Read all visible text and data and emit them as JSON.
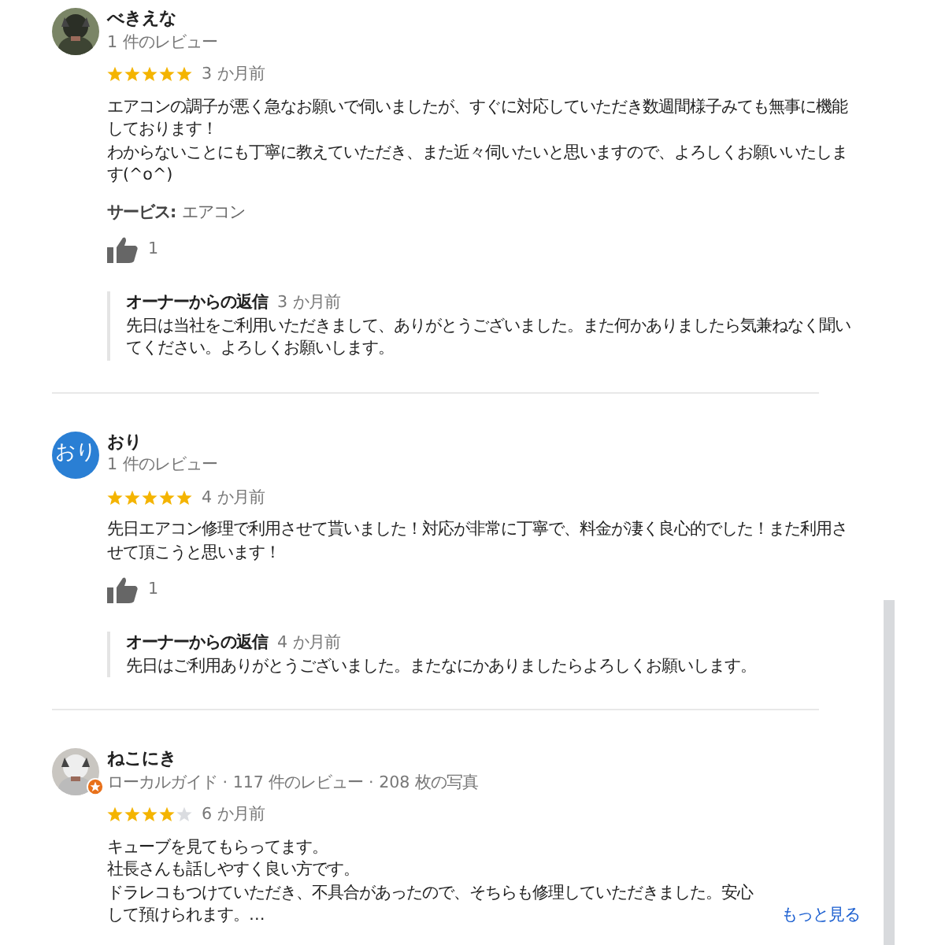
{
  "reviews": [
    {
      "name": "べきえな",
      "avatar": {
        "kind": "picture",
        "local_guide": false
      },
      "meta": "1 件のレビュー",
      "stars": 5,
      "time": "3 か月前",
      "paragraphs": [
        "エアコンの調子が悪く急なお願いで伺いましたが、すぐに対応していただき数週間様子みても無事に機能しております！",
        "わからないことにも丁寧に教えていただき、また近々伺いたいと思いますので、よろしくお願いいたします(^o^)"
      ],
      "service_label": "サービス:",
      "service_value": "エアコン",
      "likes": "1",
      "reply": {
        "title": "オーナーからの返信",
        "time": "3 か月前",
        "text": "先日は当社をご利用いただきまして、ありがとうございました。また何かありましたら気兼ねなく聞いてください。よろしくお願いします。"
      }
    },
    {
      "name": "おり",
      "avatar": {
        "kind": "initials",
        "text": "おり",
        "color": "#2a7fd4"
      },
      "meta": "1 件のレビュー",
      "stars": 5,
      "time": "4 か月前",
      "paragraphs": [
        "先日エアコン修理で利用させて貰いました！対応が非常に丁寧で、料金が凄く良心的でした！また利用させて頂こうと思います！"
      ],
      "likes": "1",
      "reply": {
        "title": "オーナーからの返信",
        "time": "4 か月前",
        "text": "先日はご利用ありがとうございました。またなにかありましたらよろしくお願いします。"
      }
    },
    {
      "name": "ねこにき",
      "avatar": {
        "kind": "picture",
        "local_guide": true
      },
      "meta": "ローカルガイド · 117 件のレビュー · 208 枚の写真",
      "stars": 4,
      "time": "6 か月前",
      "paragraphs": [
        "キューブを見てもらってます。",
        "社長さんも話しやすく良い方です。",
        "ドラレコもつけていただき、不具合があったので、そちらも修理していただきました。安心して預けられます。…"
      ],
      "more": "もっと見る"
    }
  ]
}
